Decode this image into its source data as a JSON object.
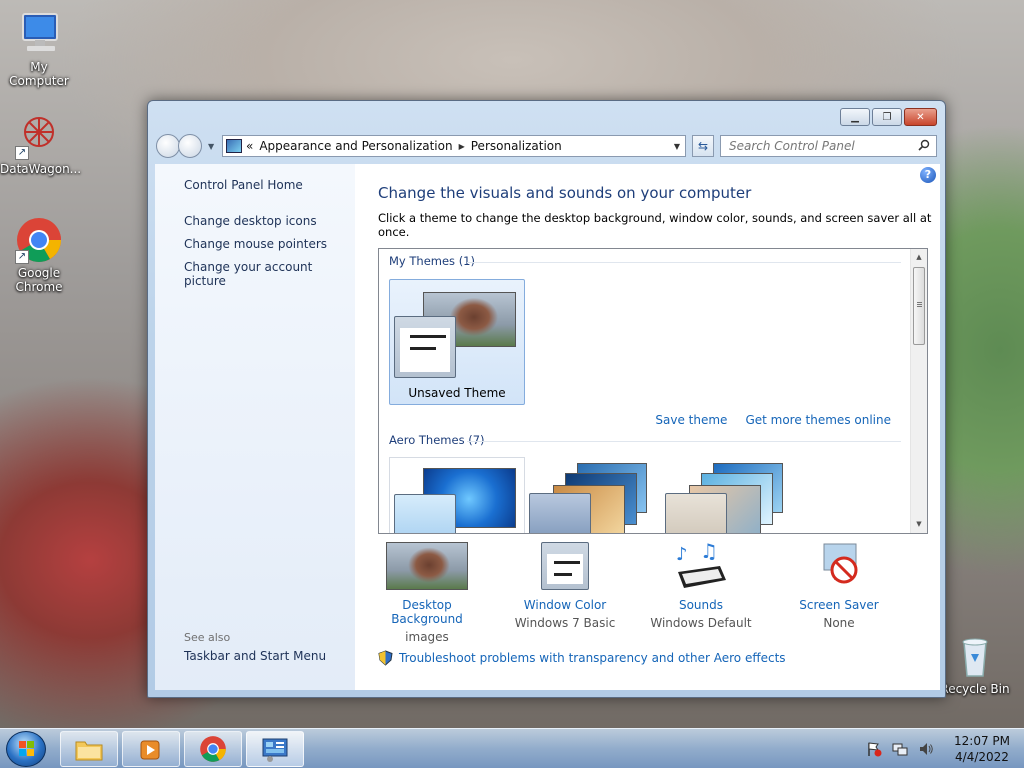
{
  "desktop": {
    "icons": [
      {
        "label": "My Computer"
      },
      {
        "label": "DataWagon..."
      },
      {
        "label": "Google Chrome"
      },
      {
        "label": "Recycle Bin"
      }
    ]
  },
  "window": {
    "address": {
      "prefix": "«",
      "crumbs": [
        "Appearance and Personalization",
        "Personalization"
      ]
    },
    "search_placeholder": "Search Control Panel",
    "sidebar": {
      "home": "Control Panel Home",
      "links": [
        "Change desktop icons",
        "Change mouse pointers",
        "Change your account picture"
      ],
      "see_also_label": "See also",
      "see_also_links": [
        "Taskbar and Start Menu"
      ]
    },
    "main": {
      "heading": "Change the visuals and sounds on your computer",
      "description": "Click a theme to change the desktop background, window color, sounds, and screen saver all at once.",
      "my_themes_label": "My Themes (1)",
      "unsaved_theme": "Unsaved Theme",
      "save_theme": "Save theme",
      "get_more_themes": "Get more themes online",
      "aero_themes_label": "Aero Themes (7)",
      "settings": [
        {
          "label": "Desktop Background",
          "value": "images"
        },
        {
          "label": "Window Color",
          "value": "Windows 7 Basic"
        },
        {
          "label": "Sounds",
          "value": "Windows Default"
        },
        {
          "label": "Screen Saver",
          "value": "None"
        }
      ],
      "troubleshoot": "Troubleshoot problems with transparency and other Aero effects"
    }
  },
  "taskbar": {
    "time": "12:07 PM",
    "date": "4/4/2022"
  },
  "colors": {
    "link": "#1565b8",
    "heading": "#1e3e7a"
  }
}
